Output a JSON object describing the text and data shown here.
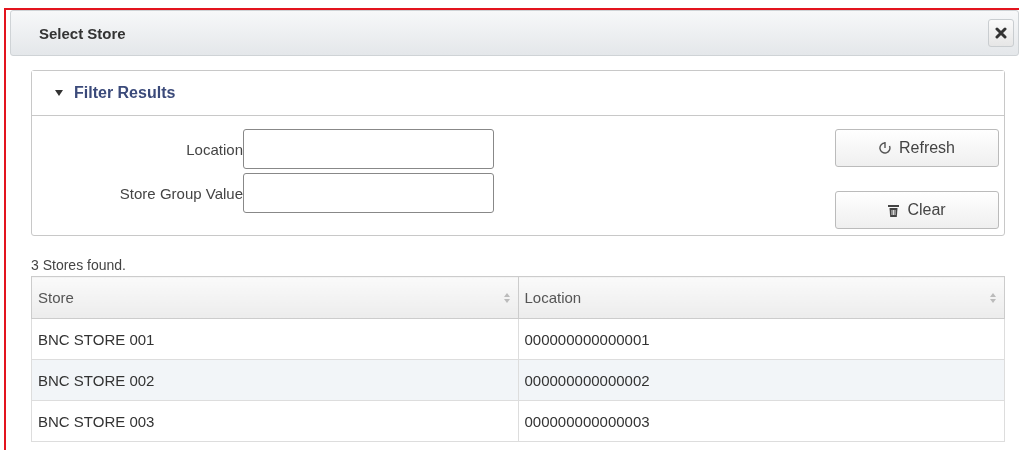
{
  "dialog": {
    "title": "Select Store"
  },
  "filter": {
    "title": "Filter Results",
    "expanded": true,
    "fields": [
      {
        "label": "Location"
      },
      {
        "label": "Store Group Value"
      }
    ],
    "buttons": [
      {
        "kind": "refresh",
        "label": "Refresh"
      },
      {
        "kind": "clear",
        "label": "Clear"
      }
    ]
  },
  "result_count": "3 Stores found.",
  "table": {
    "columns": [
      "Store",
      "Location"
    ],
    "rows": [
      [
        "BNC STORE 001",
        "000000000000001"
      ],
      [
        "BNC STORE 002",
        "000000000000002"
      ],
      [
        "BNC STORE 003",
        "000000000000003"
      ]
    ]
  }
}
